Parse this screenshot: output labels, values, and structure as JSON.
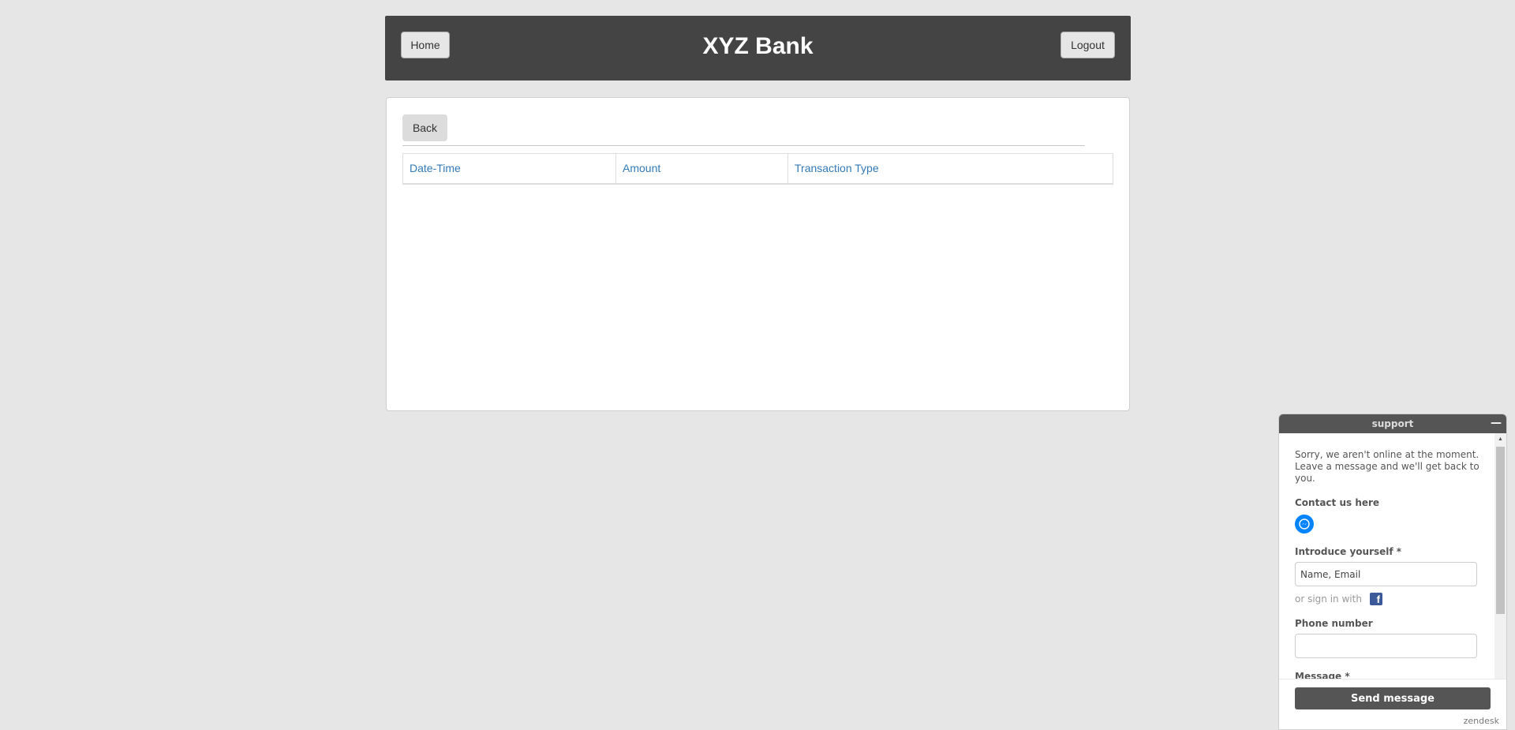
{
  "header": {
    "home_label": "Home",
    "title": "XYZ Bank",
    "logout_label": "Logout",
    "background": "#444444"
  },
  "panel": {
    "back_label": "Back",
    "columns": [
      "Date-Time",
      "Amount",
      "Transaction Type"
    ],
    "rows": []
  },
  "support": {
    "title": "support",
    "minimize_glyph": "—",
    "offline_message": "Sorry, we aren't online at the moment. Leave a message and we'll get back to you.",
    "contact_label": "Contact us here",
    "contact_icon": "messenger-icon",
    "introduce_label": "Introduce yourself *",
    "introduce_placeholder": "Name, Email",
    "signin_text": "or sign in with",
    "signin_icon": "facebook-icon",
    "phone_label": "Phone number",
    "phone_value": "",
    "message_label": "Message *",
    "send_label": "Send message",
    "brand": "zendesk"
  },
  "colors": {
    "page_background": "#e6e6e6",
    "link": "#337ab7",
    "messenger": "#0084ff",
    "facebook": "#3b5998"
  }
}
